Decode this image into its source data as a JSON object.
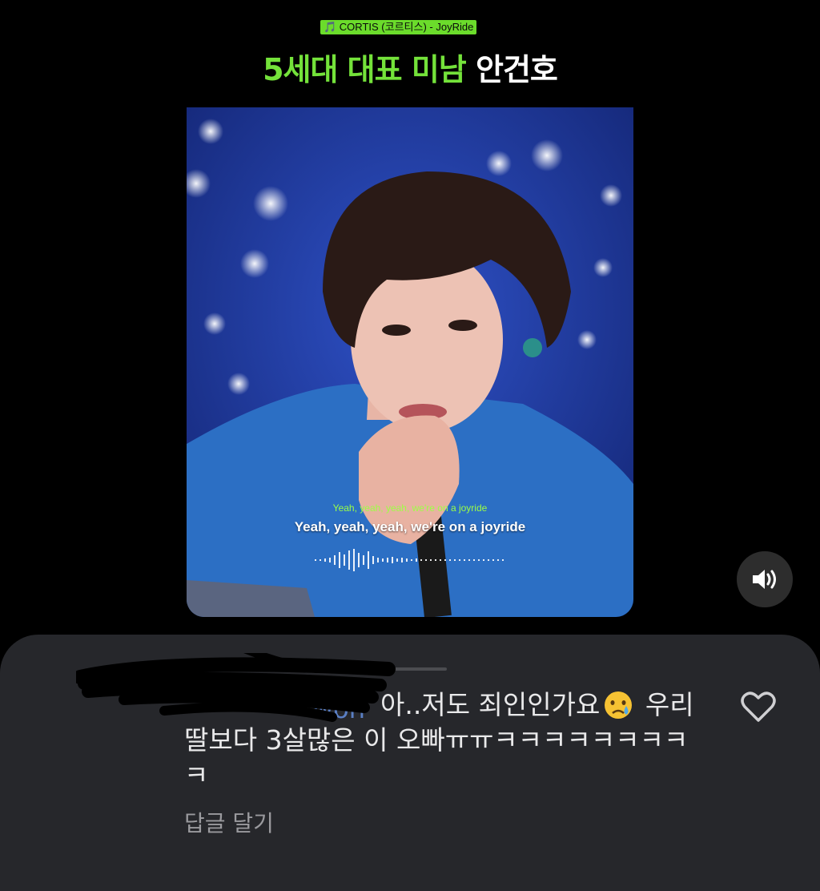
{
  "song_tag": "🎵 CORTIS (코르티스) - JoyRide",
  "title": {
    "highlight": "5세대 대표 미남",
    "name": "안건호"
  },
  "video": {
    "lyric_small": "Yeah, yeah, yeah, we're on a joyride",
    "lyric_main": "Yeah, yeah, yeah, we're on a joyride"
  },
  "volume_icon": "speaker-volume-icon",
  "comment": {
    "username_fragment": "won",
    "text_before_emoji": "아..저도 죄인인가요",
    "text_after_emoji": " 우리딸보다 3살많은 이 오빠ㅠㅠㅋㅋㅋㅋㅋㅋㅋㅋㅋ",
    "emoji": "crying-face",
    "reply_label": "답글 달기",
    "like_icon": "heart-icon"
  },
  "colors": {
    "accent_green": "#74e23a",
    "sheet_bg": "#26272b",
    "background": "#000000"
  }
}
